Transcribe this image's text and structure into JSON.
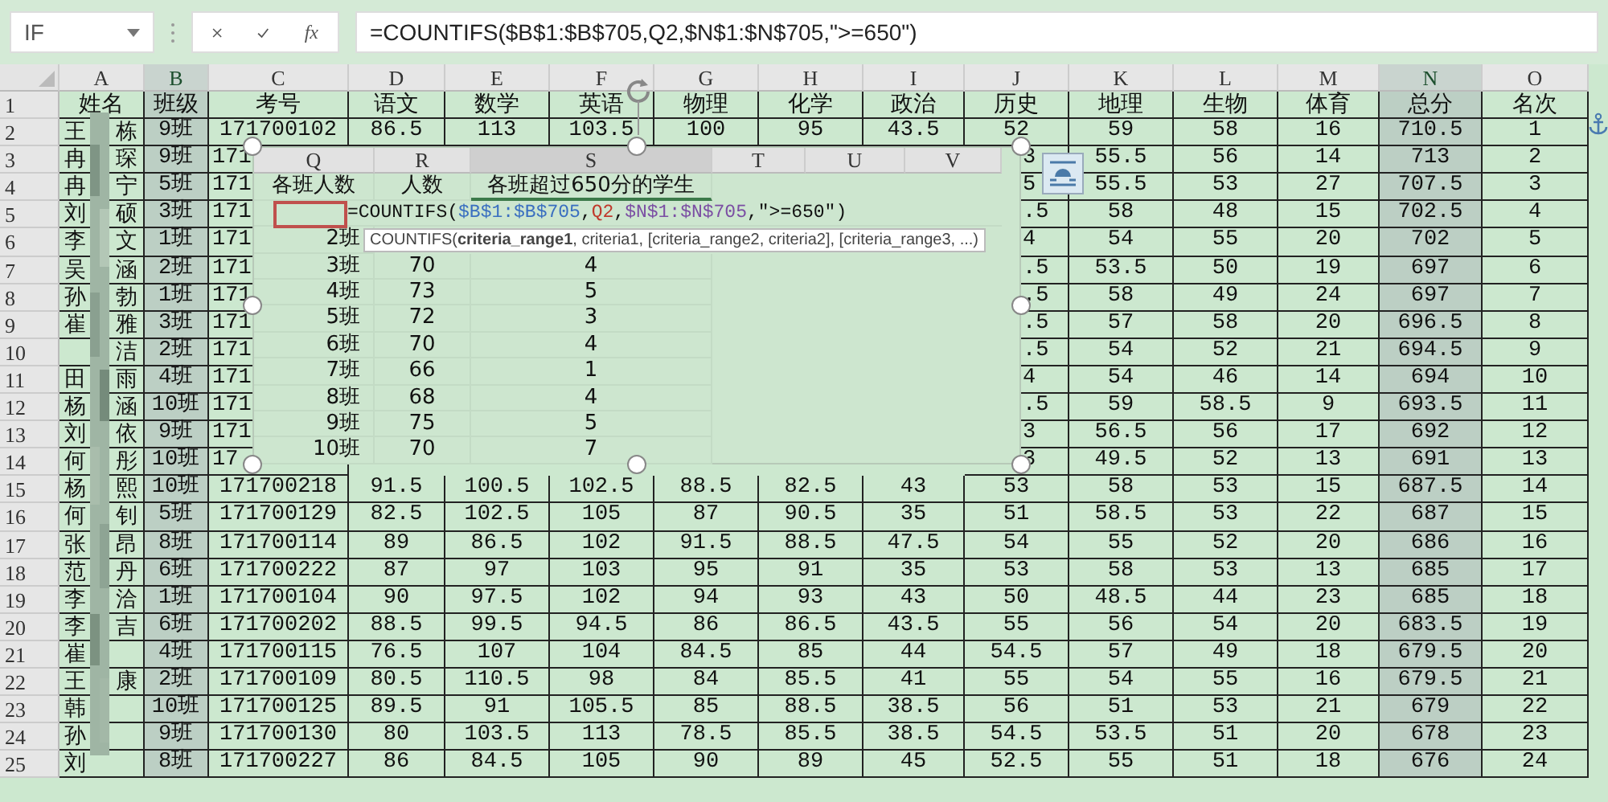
{
  "name_box": {
    "value": "IF"
  },
  "formula_bar": {
    "function_button": "fx",
    "value": "=COUNTIFS($B$1:$B$705,Q2,$N$1:$N$705,\">=650\")"
  },
  "columns": [
    {
      "label": "A",
      "selected": false
    },
    {
      "label": "B",
      "selected": true
    },
    {
      "label": "C",
      "selected": false
    },
    {
      "label": "D",
      "selected": false
    },
    {
      "label": "E",
      "selected": false
    },
    {
      "label": "F",
      "selected": false
    },
    {
      "label": "G",
      "selected": false
    },
    {
      "label": "H",
      "selected": false
    },
    {
      "label": "I",
      "selected": false
    },
    {
      "label": "J",
      "selected": false
    },
    {
      "label": "K",
      "selected": false
    },
    {
      "label": "L",
      "selected": false
    },
    {
      "label": "M",
      "selected": false
    },
    {
      "label": "N",
      "selected": true
    },
    {
      "label": "O",
      "selected": false
    }
  ],
  "header_row": {
    "number": "1",
    "cells": [
      "姓名",
      "班级",
      "考号",
      "语文",
      "数学",
      "英语",
      "物理",
      "化学",
      "政治",
      "历史",
      "地理",
      "生物",
      "体育",
      "总分",
      "名次"
    ]
  },
  "rows": [
    {
      "number": "2",
      "covered": false,
      "name": {
        "first": "王",
        "last": "栋"
      },
      "cells": [
        "9班",
        "171700102",
        "86.5",
        "113",
        "103.5",
        "100",
        "95",
        "43.5",
        "52",
        "59",
        "58",
        "16",
        "710.5",
        "1"
      ]
    },
    {
      "number": "3",
      "covered": true,
      "name": {
        "first": "冉",
        "last": "琛"
      },
      "cells": [
        "9班",
        "171",
        null,
        null,
        null,
        null,
        null,
        null,
        "3",
        "55.5",
        "56",
        "14",
        "713",
        "2"
      ]
    },
    {
      "number": "4",
      "covered": true,
      "name": {
        "first": "冉",
        "last": "宁"
      },
      "cells": [
        "5班",
        "171",
        null,
        null,
        null,
        null,
        null,
        null,
        "5",
        "55.5",
        "53",
        "27",
        "707.5",
        "3"
      ]
    },
    {
      "number": "5",
      "covered": true,
      "name": {
        "first": "刘",
        "last": "硕"
      },
      "cells": [
        "3班",
        "171",
        null,
        null,
        null,
        null,
        null,
        null,
        ".5",
        "58",
        "48",
        "15",
        "702.5",
        "4"
      ]
    },
    {
      "number": "6",
      "covered": true,
      "name": {
        "first": "李",
        "last": "文"
      },
      "cells": [
        "1班",
        "171",
        null,
        null,
        null,
        null,
        null,
        null,
        "4",
        "54",
        "55",
        "20",
        "702",
        "5"
      ]
    },
    {
      "number": "7",
      "covered": true,
      "name": {
        "first": "吴",
        "last": "涵"
      },
      "cells": [
        "2班",
        "171",
        null,
        null,
        null,
        null,
        null,
        null,
        ".5",
        "53.5",
        "50",
        "19",
        "697",
        "6"
      ]
    },
    {
      "number": "8",
      "covered": true,
      "name": {
        "first": "孙",
        "last": "勃"
      },
      "cells": [
        "1班",
        "171",
        null,
        null,
        null,
        null,
        null,
        null,
        ".5",
        "58",
        "49",
        "24",
        "697",
        "7"
      ]
    },
    {
      "number": "9",
      "covered": true,
      "name": {
        "first": "崔",
        "last": "雅"
      },
      "cells": [
        "3班",
        "171",
        null,
        null,
        null,
        null,
        null,
        null,
        ".5",
        "57",
        "58",
        "20",
        "696.5",
        "8"
      ]
    },
    {
      "number": "10",
      "covered": true,
      "name": {
        "last": "洁"
      },
      "cells": [
        "2班",
        "171",
        null,
        null,
        null,
        null,
        null,
        null,
        ".5",
        "54",
        "52",
        "21",
        "694.5",
        "9"
      ]
    },
    {
      "number": "11",
      "covered": true,
      "name": {
        "first": "田",
        "last": "雨"
      },
      "cells": [
        "4班",
        "171",
        null,
        null,
        null,
        null,
        null,
        null,
        "4",
        "54",
        "46",
        "14",
        "694",
        "10"
      ]
    },
    {
      "number": "12",
      "covered": true,
      "name": {
        "first": "杨",
        "last": "涵"
      },
      "cells": [
        "10班",
        "171",
        null,
        null,
        null,
        null,
        null,
        null,
        ".5",
        "59",
        "58.5",
        "9",
        "693.5",
        "11"
      ]
    },
    {
      "number": "13",
      "covered": true,
      "name": {
        "first": "刘",
        "last": "依"
      },
      "cells": [
        "9班",
        "171",
        null,
        null,
        null,
        null,
        null,
        null,
        "3",
        "56.5",
        "56",
        "17",
        "692",
        "12"
      ]
    },
    {
      "number": "14",
      "covered": true,
      "name": {
        "first": "何",
        "last": "彤"
      },
      "cells": [
        "10班",
        "17",
        null,
        null,
        null,
        null,
        null,
        null,
        "3",
        "49.5",
        "52",
        "13",
        "691",
        "13"
      ]
    },
    {
      "number": "15",
      "covered": false,
      "name": {
        "first": "杨",
        "last": "熙"
      },
      "cells": [
        "10班",
        "171700218",
        "91.5",
        "100.5",
        "102.5",
        "88.5",
        "82.5",
        "43",
        "53",
        "58",
        "53",
        "15",
        "687.5",
        "14"
      ]
    },
    {
      "number": "16",
      "covered": false,
      "name": {
        "first": "何",
        "last": "钊"
      },
      "cells": [
        "5班",
        "171700129",
        "82.5",
        "102.5",
        "105",
        "87",
        "90.5",
        "35",
        "51",
        "58.5",
        "53",
        "22",
        "687",
        "15"
      ]
    },
    {
      "number": "17",
      "covered": false,
      "name": {
        "first": "张",
        "last": "昂"
      },
      "cells": [
        "8班",
        "171700114",
        "89",
        "86.5",
        "102",
        "91.5",
        "88.5",
        "47.5",
        "54",
        "55",
        "52",
        "20",
        "686",
        "16"
      ]
    },
    {
      "number": "18",
      "covered": false,
      "name": {
        "first": "范",
        "last": "丹"
      },
      "cells": [
        "6班",
        "171700222",
        "87",
        "97",
        "103",
        "95",
        "91",
        "35",
        "53",
        "58",
        "53",
        "13",
        "685",
        "17"
      ]
    },
    {
      "number": "19",
      "covered": false,
      "name": {
        "first": "李",
        "last": "洽"
      },
      "cells": [
        "1班",
        "171700104",
        "90",
        "97.5",
        "102",
        "94",
        "93",
        "43",
        "50",
        "48.5",
        "44",
        "23",
        "685",
        "18"
      ]
    },
    {
      "number": "20",
      "covered": false,
      "name": {
        "first": "李",
        "last": "吉"
      },
      "cells": [
        "6班",
        "171700202",
        "88.5",
        "99.5",
        "94.5",
        "86",
        "86.5",
        "43.5",
        "55",
        "56",
        "54",
        "20",
        "683.5",
        "19"
      ]
    },
    {
      "number": "21",
      "covered": false,
      "name": {
        "first": "崔"
      },
      "cells": [
        "4班",
        "171700115",
        "76.5",
        "107",
        "104",
        "84.5",
        "85",
        "44",
        "54.5",
        "57",
        "49",
        "18",
        "679.5",
        "20"
      ]
    },
    {
      "number": "22",
      "covered": false,
      "name": {
        "first": "王",
        "last": "康"
      },
      "cells": [
        "2班",
        "171700109",
        "80.5",
        "110.5",
        "98",
        "84",
        "85.5",
        "41",
        "55",
        "54",
        "55",
        "16",
        "679.5",
        "21"
      ]
    },
    {
      "number": "23",
      "covered": false,
      "name": {
        "first": "韩"
      },
      "cells": [
        "10班",
        "171700125",
        "89.5",
        "91",
        "105.5",
        "85",
        "88.5",
        "38.5",
        "56",
        "51",
        "53",
        "21",
        "679",
        "22"
      ]
    },
    {
      "number": "24",
      "covered": false,
      "name": {
        "first": "孙"
      },
      "cells": [
        "9班",
        "171700130",
        "80",
        "103.5",
        "113",
        "78.5",
        "85.5",
        "38.5",
        "54.5",
        "53.5",
        "51",
        "20",
        "678",
        "23"
      ]
    },
    {
      "number": "25",
      "covered": false,
      "name": {
        "first": "刘"
      },
      "cells": [
        "8班",
        "171700227",
        "86",
        "84.5",
        "105",
        "90",
        "89",
        "45",
        "52.5",
        "55",
        "51",
        "18",
        "676",
        "24"
      ]
    }
  ],
  "embedded_table": {
    "columns": [
      {
        "label": "Q",
        "selected": false
      },
      {
        "label": "R",
        "selected": false
      },
      {
        "label": "S",
        "selected": true
      },
      {
        "label": "T",
        "selected": false
      },
      {
        "label": "U",
        "selected": false
      },
      {
        "label": "V",
        "selected": false
      }
    ],
    "headings": [
      "各班人数",
      "人数",
      "各班超过650分的学生"
    ],
    "formula_parts": [
      {
        "text": "=COUNTIFS(",
        "color": "#111111"
      },
      {
        "text": "$B$1:$B$705",
        "color": "#3a6fc0"
      },
      {
        "text": ",",
        "color": "#111111"
      },
      {
        "text": "Q2",
        "color": "#c0392b"
      },
      {
        "text": ",",
        "color": "#111111"
      },
      {
        "text": "$N$1:$N$705",
        "color": "#7b4ea3"
      },
      {
        "text": ",\">=650\")",
        "color": "#111111"
      }
    ],
    "tooltip": "COUNTIFS(**criteria_range1**, criteria1, [criteria_range2, criteria2], [criteria_range3, ...)",
    "rows": [
      {
        "class": "2班"
      },
      {
        "class": "3班",
        "count": "70",
        "over_650": "4"
      },
      {
        "class": "4班",
        "count": "73",
        "over_650": "5"
      },
      {
        "class": "5班",
        "count": "72",
        "over_650": "3"
      },
      {
        "class": "6班",
        "count": "70",
        "over_650": "4"
      },
      {
        "class": "7班",
        "count": "66",
        "over_650": "1"
      },
      {
        "class": "8班",
        "count": "68",
        "over_650": "4"
      },
      {
        "class": "9班",
        "count": "75",
        "over_650": "5"
      },
      {
        "class": "10班",
        "count": "70",
        "over_650": "7"
      }
    ]
  }
}
